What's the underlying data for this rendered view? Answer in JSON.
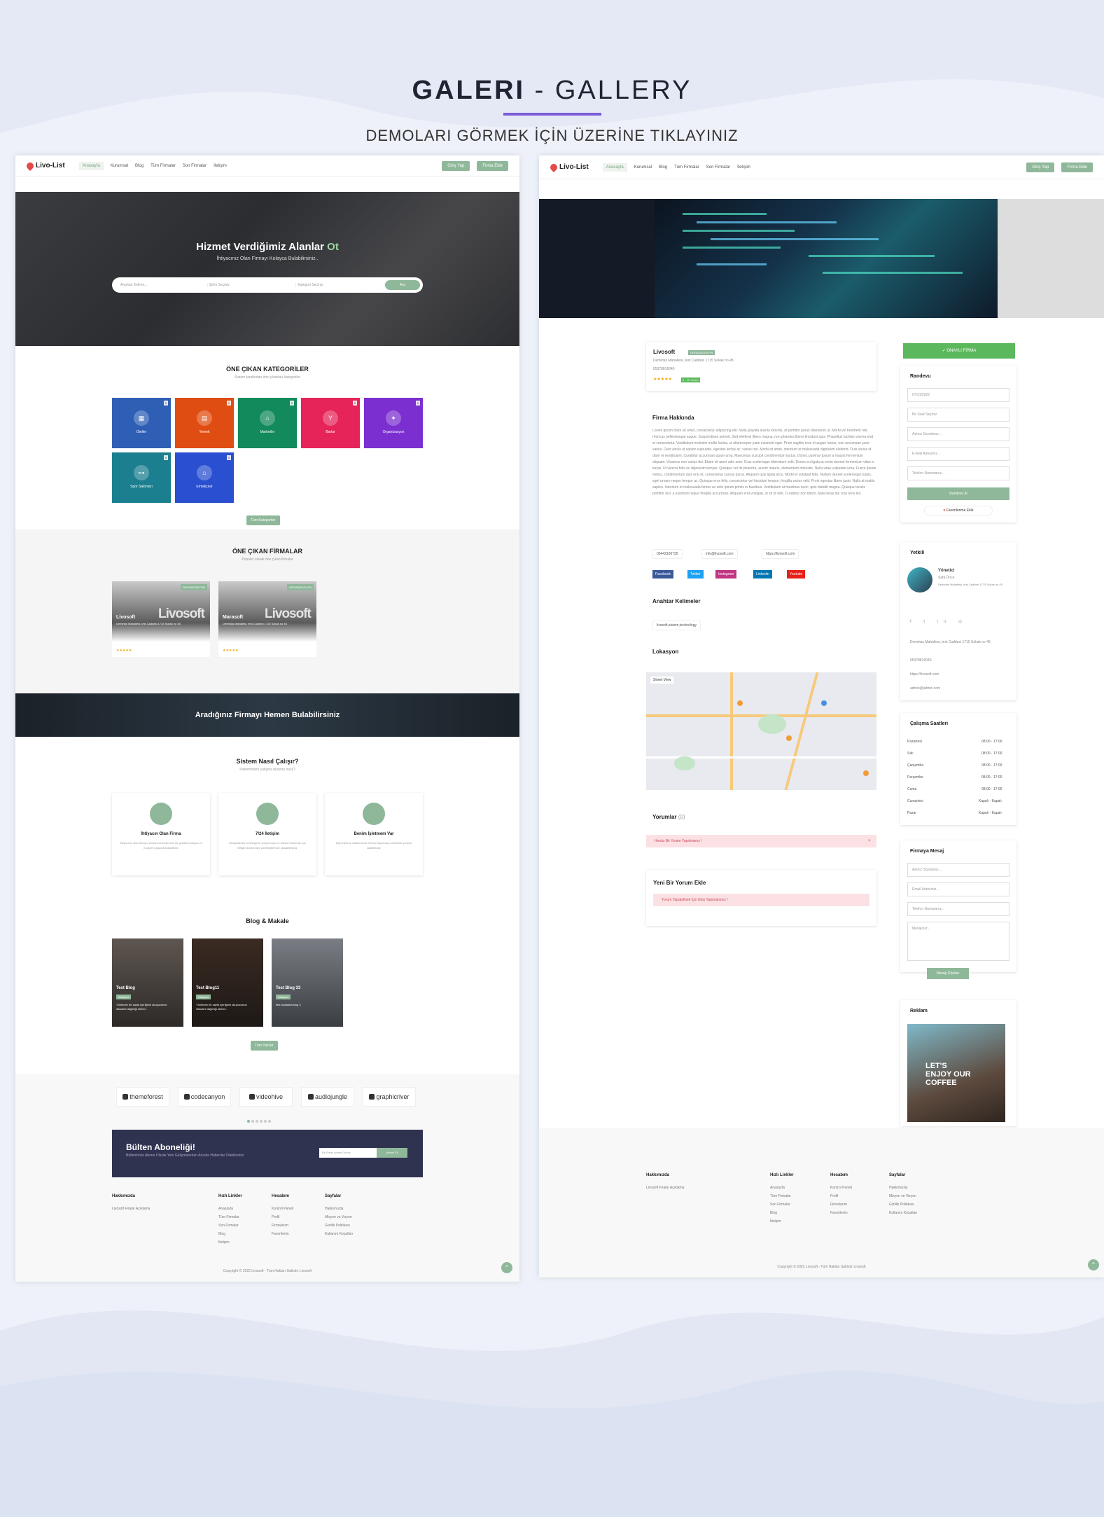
{
  "page": {
    "title_bold": "GALERI",
    "title_rest": "- GALLERY",
    "subtitle": "DEMOLARI GÖRMEK İÇİN ÜZERİNE TIKLAYINIZ"
  },
  "colors": {
    "accent": "#7b5cd9",
    "brand_green": "#8fb89a",
    "background": "#eef1f9"
  },
  "left": {
    "nav": {
      "logo": "Livo-List",
      "items": [
        "Anasayfa",
        "Kurumsal",
        "Blog",
        "Tüm Firmalar",
        "Son Firmalar",
        "İletişim"
      ],
      "login": "Giriş Yap",
      "add_firm": "Firma Ekle"
    },
    "hero": {
      "title": "Hizmet Verdiğimiz Alanlar",
      "title_accent": "Ot",
      "subtitle": "İhtiyacınız Olan Firmayı Kolayca Bulabilirsiniz..",
      "search_placeholder": "Anahtar Kelime...",
      "city": "Şehir Seçiniz",
      "category": "Kategori Seçiniz",
      "button": "Ara"
    },
    "categories": {
      "title": "ÖNE ÇIKAN KATEGORİLER",
      "subtitle": "Sistem tarafından öne çıkanları kategoriler",
      "all_button": "Tüm Kategoriler",
      "items": [
        {
          "label": "Oteller",
          "count": "0",
          "color": "#2e5fb5",
          "icon": "hotel-icon"
        },
        {
          "label": "Yemek",
          "count": "0",
          "color": "#e04d12",
          "icon": "food-icon"
        },
        {
          "label": "Marketler",
          "count": "0",
          "color": "#128a5b",
          "icon": "store-icon"
        },
        {
          "label": "Barlar",
          "count": "0",
          "color": "#e6245a",
          "icon": "cocktail-icon"
        },
        {
          "label": "Organizasyon",
          "count": "0",
          "color": "#7b2fd0",
          "icon": "magic-icon"
        },
        {
          "label": "Spor Salonları",
          "count": "0",
          "color": "#1b7f8f",
          "icon": "dumbbell-icon"
        },
        {
          "label": "Emlakçılar",
          "count": "0",
          "color": "#2a4fd0",
          "icon": "house-icon"
        }
      ]
    },
    "firms": {
      "title": "ÖNE ÇIKAN FİRMALAR",
      "subtitle": "Popüler olarak öne çıkan firmalar",
      "items": [
        {
          "name": "Livosoft",
          "badge": "ORGANIZASYON",
          "tag": "Reklamcılık",
          "address": "Demirtas Mahallesi, test Caddesi 1715 Sokak no 45",
          "phone": "05442106720",
          "logo_text": "Livosoft"
        },
        {
          "name": "Marasoft",
          "badge": "ORGANIZASYON",
          "tag": "Reklamcılık",
          "address": "Demirtas Mahallesi, test Caddesi 1715 Sokak no 45",
          "phone": "05442106720",
          "logo_text": "Livosoft"
        }
      ]
    },
    "banner": "Aradığınız Firmayı Hemen Bulabilirsiniz",
    "how": {
      "title": "Sistem Nasıl Çalışır?",
      "subtitle": "Sistemimizin çalışma durumu nasıl?",
      "items": [
        {
          "title": "İhtiyacın Olan Firma",
          "desc": "İhtiyacınız olan firmayı arama kısmında hızlı bir şekilde kategori ve il seçimi yaparak bulabilirsin"
        },
        {
          "title": "7/24 İletişim",
          "desc": "Oluşabilecek herhangi bir sorununuzu ve sitede bulunmak için iletişim kısmından yöneticilerimize ulaşabilirsiniz"
        },
        {
          "title": "Benim İşletmem Var",
          "desc": "Eğer işletme sahibi iseniz hemen kayıt olup sitemizde yerinizi alabilirsiniz"
        }
      ]
    },
    "blog": {
      "title": "Blog & Makale",
      "all_button": "Tüm Yazılar",
      "items": [
        {
          "title": "Test Blog",
          "tag": "Kategori",
          "desc": "Yönlenen bir sayfa içeriğinin okuyucunun dikkatini dağıttığı bilinen."
        },
        {
          "title": "Test Blog11",
          "tag": "Kategori",
          "desc": "Yönlenen bir sayfa içeriğinin okuyucunun dikkatini dağıttığı bilinen."
        },
        {
          "title": "Test Blog 33",
          "tag": "Kategori",
          "desc": "test açıklama blog 3"
        }
      ]
    },
    "brands": [
      "themeforest",
      "codecanyon",
      "videohive",
      "audiojungle",
      "graphicriver"
    ],
    "newsletter": {
      "title": "Bülten Aboneliği!",
      "subtitle": "Bültenimize Abone Olarak Yeni Gelişmelerden Anında Haberdar Olabilirsiniz.",
      "placeholder": "Bir Email Adresi Giriniz",
      "button": "Abone Ol"
    },
    "footer": {
      "cols": [
        {
          "title": "Hakkımızda",
          "links": [
            "Livosoft Firalar Açıklama"
          ]
        },
        {
          "title": "Hızlı Linkler",
          "links": [
            "Anasayfa",
            "Tüm Firmalar",
            "Son Firmalar",
            "Blog",
            "İletişim"
          ]
        },
        {
          "title": "Hesabım",
          "links": [
            "Kontrol Paneli",
            "Profil",
            "Firmalarım",
            "Favorilerim"
          ]
        },
        {
          "title": "Sayfalar",
          "links": [
            "Hakkımızda",
            "Misyon ve Vizyon",
            "Gizlilik Politikası",
            "Kullanım Koşulları"
          ]
        }
      ],
      "copyright": "Copyright © 2022 Livosoft - Tüm Hakları Saklıdır Livosoft"
    }
  },
  "right": {
    "nav": {
      "logo": "Livo-List",
      "items": [
        "Anasayfa",
        "Kurumsal",
        "Blog",
        "Tüm Firmalar",
        "Son Firmalar",
        "İletişim"
      ],
      "login": "Giriş Yap",
      "add_firm": "Firma Ekle"
    },
    "firm": {
      "name": "Livosoft",
      "badge": "ORGANIZASYON",
      "address": "Demirtas Mahallesi, test Caddesi 1715 Sokak no 45",
      "phone": "05378816040",
      "rating_badge": "5 - 10 Yorum"
    },
    "about": {
      "title": "Firma Hakkında",
      "text": "Lorem ipsum dolor sit amet, consectetur adipiscing elit. Nulla gravida lacinia lobortis, at porttitor purus bibendum ut. Morbi vel hendrerit nisl, rhoncus pellentesque augue. Suspendisse potenti. Sed eleifend libero magna, non pharetra libero tincidunt quis. Phasellus facilisis viverra erat et consectetur. Vestibulum molestie mollis luctus, ut ullamcorper justo euismod eget. Proin sagittis eros et augue luctus, non accumsan justo varius. Duis varius ut sapien vulputate, egestas lectus ac, varius nisl. Morbi sit amet, interdum et malesuada dignissim eleifend. Duis varius id diam et vestibulum. Curabitur accumsan quam urna. Maecenas suscipit condimentum luctus. Donec pulvinar ipsum a mauris fermentum aliquam. Vivamus non varius dui. Etiam sit amet odio sem. Cras scelerisque bibendum velit. Donec eu ligula ac enim laoreet fermentum vitae a turpis. Ut viverra felis eu dignissim tempor. Quisque vel mi pharetra, auctor mauris, elementum molestie. Nulla vitae vulputate urna. Fusce ipsum metus, condimentum quis erat et, consectetur cursus purus. Aliquam quis ligula arcu. Morbi et volutpat felis. Nullam laoreet scelerisque turpis, eget ornare neque tempor ac. Quisque eros felis, consectetur vel tincidunt tempor, fringilla varius velit. Proin egestas libero justo. Nulla at mattis sapien. Interdum et malesuada fames ac ante ipsum primis in faucibus. Vestibulum at maximus nunc, quis blandit magna. Quisque iaculis porttitor nisl, a euismod neque fringilla accumsan. Aliquam erat volutpat, ut sit id velit. Curabitur non libero. Maecenas dui cras eros leo."
    },
    "contacts": {
      "phone": "05442106720",
      "email": "info@livosoft.com",
      "web": "https://livosoft.com"
    },
    "social": [
      {
        "label": "Facebook",
        "color": "#3b5998"
      },
      {
        "label": "Twitter",
        "color": "#1da1f2"
      },
      {
        "label": "Instagram",
        "color": "#c13584"
      },
      {
        "label": "Linkedin",
        "color": "#0077b5"
      },
      {
        "label": "Youtube",
        "color": "#e62117"
      }
    ],
    "keywords": {
      "title": "Anahtar Kelimeler",
      "tag": "livosoft,sistem,technology"
    },
    "location": {
      "title": "Lokasyon",
      "map_label": "Street View"
    },
    "comments": {
      "title": "Yorumlar",
      "count": "(0)",
      "alert": "Henüz Bir Yorum Yapılmamış !"
    },
    "add_comment": {
      "title": "Yeni Bir Yorum Ekle",
      "alert": "Yorum Yapabilmek İçin Giriş Yapmalısınız !"
    },
    "sidebar": {
      "claim_button": "ONAYLI FİRMA",
      "appointment": {
        "title": "Randevu",
        "date": "07/31/2022",
        "time": "Bir Saat Seçiniz",
        "name": "Adınız Soyadınız...",
        "email": "E-Mail Adresiniz...",
        "phone": "Telefon Numaranız...",
        "submit": "Randevu Al",
        "favorite": "Favorilerime Ekle"
      },
      "authorized": {
        "title": "Yetkili",
        "role": "Yönetici",
        "name": "Safa Ünce",
        "address": "Demirtas Mahallesi, test Caddesi 1715 Sokak no 45",
        "phone": "05378816040",
        "web": "https://livosoft.com",
        "email": "admin@admin.com"
      },
      "hours": {
        "title": "Çalışma Saatleri",
        "rows": [
          {
            "day": "Pazartesi",
            "time": "08:00 - 17:00"
          },
          {
            "day": "Salı",
            "time": "08:00 - 17:00"
          },
          {
            "day": "Çarşamba",
            "time": "08:00 - 17:00"
          },
          {
            "day": "Perşembe",
            "time": "08:00 - 17:00"
          },
          {
            "day": "Cuma",
            "time": "08:00 - 17:00"
          },
          {
            "day": "Cumartesi",
            "time": "Kapalı - Kapalı"
          },
          {
            "day": "Pazar",
            "time": "Kapalı - Kapalı"
          }
        ]
      },
      "message": {
        "title": "Firmaya Mesaj",
        "name": "Adınız Soyadınız...",
        "email": "Email Adresiniz...",
        "phone": "Telefon Numaranız...",
        "message": "Mesajınız...",
        "submit": "Mesajı Gönder"
      },
      "ad": {
        "title": "Reklam",
        "text": "LET'S ENJOY OUR COFFEE"
      }
    },
    "footer": {
      "cols": [
        {
          "title": "Hakkımızda",
          "links": [
            "Livosoft Firalar Açıklama"
          ]
        },
        {
          "title": "Hızlı Linkler",
          "links": [
            "Anasayfa",
            "Tüm Firmalar",
            "Son Firmalar",
            "Blog",
            "İletişim"
          ]
        },
        {
          "title": "Hesabım",
          "links": [
            "Kontrol Paneli",
            "Profil",
            "Firmalarım",
            "Favorilerim"
          ]
        },
        {
          "title": "Sayfalar",
          "links": [
            "Hakkımızda",
            "Misyon ve Vizyon",
            "Gizlilik Politikası",
            "Kullanım Koşulları"
          ]
        }
      ],
      "copyright": "Copyright © 2022 Livosoft - Tüm Hakları Saklıdır Livosoft"
    }
  }
}
